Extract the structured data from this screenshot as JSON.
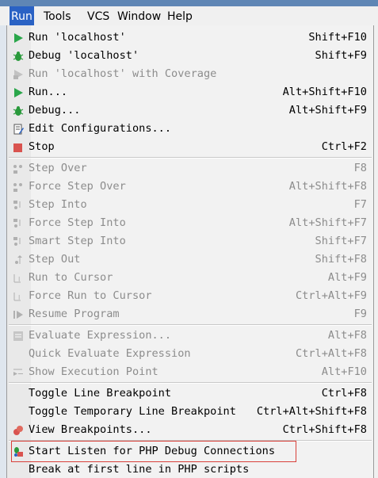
{
  "menubar": {
    "items": [
      {
        "label": "Run",
        "active": true
      },
      {
        "label": "Tools"
      },
      {
        "label": "VCS"
      },
      {
        "label": "Window"
      },
      {
        "label": "Help"
      }
    ]
  },
  "menu": {
    "groups": [
      [
        {
          "label": "Run 'localhost'",
          "shortcut": "Shift+F10",
          "icon": "run-icon",
          "enabled": true
        },
        {
          "label": "Debug 'localhost'",
          "shortcut": "Shift+F9",
          "icon": "debug-bug-icon",
          "enabled": true
        },
        {
          "label": "Run 'localhost' with Coverage",
          "shortcut": "",
          "icon": "coverage-icon",
          "enabled": false
        },
        {
          "label": "Run...",
          "shortcut": "Alt+Shift+F10",
          "icon": "run-icon",
          "enabled": true
        },
        {
          "label": "Debug...",
          "shortcut": "Alt+Shift+F9",
          "icon": "debug-bug-icon",
          "enabled": true
        },
        {
          "label": "Edit Configurations...",
          "shortcut": "",
          "icon": "edit-config-icon",
          "enabled": true
        },
        {
          "label": "Stop",
          "shortcut": "Ctrl+F2",
          "icon": "stop-icon",
          "enabled": true
        }
      ],
      [
        {
          "label": "Step Over",
          "shortcut": "F8",
          "icon": "step-over-icon",
          "enabled": false
        },
        {
          "label": "Force Step Over",
          "shortcut": "Alt+Shift+F8",
          "icon": "force-step-over-icon",
          "enabled": false
        },
        {
          "label": "Step Into",
          "shortcut": "F7",
          "icon": "step-into-icon",
          "enabled": false
        },
        {
          "label": "Force Step Into",
          "shortcut": "Alt+Shift+F7",
          "icon": "force-step-into-icon",
          "enabled": false
        },
        {
          "label": "Smart Step Into",
          "shortcut": "Shift+F7",
          "icon": "smart-step-into-icon",
          "enabled": false
        },
        {
          "label": "Step Out",
          "shortcut": "Shift+F8",
          "icon": "step-out-icon",
          "enabled": false
        },
        {
          "label": "Run to Cursor",
          "shortcut": "Alt+F9",
          "icon": "run-to-cursor-icon",
          "enabled": false
        },
        {
          "label": "Force Run to Cursor",
          "shortcut": "Ctrl+Alt+F9",
          "icon": "force-run-to-cursor-icon",
          "enabled": false
        },
        {
          "label": "Resume Program",
          "shortcut": "F9",
          "icon": "resume-icon",
          "enabled": false
        }
      ],
      [
        {
          "label": "Evaluate Expression...",
          "shortcut": "Alt+F8",
          "icon": "evaluate-icon",
          "enabled": false
        },
        {
          "label": "Quick Evaluate Expression",
          "shortcut": "Ctrl+Alt+F8",
          "icon": "",
          "enabled": false
        },
        {
          "label": "Show Execution Point",
          "shortcut": "Alt+F10",
          "icon": "execution-point-icon",
          "enabled": false
        }
      ],
      [
        {
          "label": "Toggle Line Breakpoint",
          "shortcut": "Ctrl+F8",
          "icon": "",
          "enabled": true
        },
        {
          "label": "Toggle Temporary Line Breakpoint",
          "shortcut": "Ctrl+Alt+Shift+F8",
          "icon": "",
          "enabled": true
        },
        {
          "label": "View Breakpoints...",
          "shortcut": "Ctrl+Shift+F8",
          "icon": "breakpoints-icon",
          "enabled": true
        }
      ],
      [
        {
          "label": "Start Listen for PHP Debug Connections",
          "shortcut": "",
          "icon": "php-listen-icon",
          "enabled": true,
          "highlighted": true
        },
        {
          "label": "Break at first line in PHP scripts",
          "shortcut": "",
          "icon": "",
          "enabled": true
        }
      ]
    ]
  },
  "colors": {
    "menubar_active": "#2a62c4",
    "run_green": "#2aa64a",
    "stop_red": "#d9534f",
    "highlight_box": "#d9403a",
    "disabled_text": "#8c8c8c"
  }
}
